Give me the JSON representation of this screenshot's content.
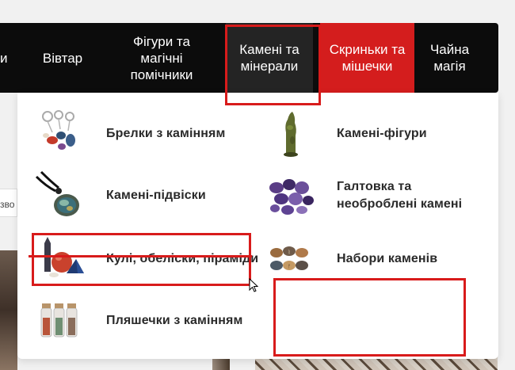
{
  "background": {
    "strip_text": "зво"
  },
  "nav": {
    "items": [
      {
        "id": "cut",
        "label": "и"
      },
      {
        "id": "altar",
        "label": "Вівтар"
      },
      {
        "id": "figures",
        "label": "Фігури та магічні помічники"
      },
      {
        "id": "stones",
        "label": "Камені та мінерали",
        "active": true
      },
      {
        "id": "boxes",
        "label": "Скриньки та мішечки",
        "promo": true
      },
      {
        "id": "tea",
        "label": "Чайна магія"
      }
    ]
  },
  "dropdown": {
    "items": [
      {
        "id": "keychains",
        "label": "Брелки з камінням",
        "icon": "keychain-stones-icon"
      },
      {
        "id": "figurines",
        "label": "Камені-фігури",
        "icon": "stone-figurine-icon"
      },
      {
        "id": "pendants",
        "label": "Камені-підвіски",
        "icon": "stone-pendant-icon"
      },
      {
        "id": "tumbled",
        "label": "Галтовка та необроблені камені",
        "icon": "tumbled-stones-icon"
      },
      {
        "id": "spheres",
        "label": "Кулі, обеліски, піраміди",
        "icon": "sphere-obelisk-pyramid-icon"
      },
      {
        "id": "sets",
        "label": "Набори каменів",
        "icon": "stone-set-icon"
      },
      {
        "id": "bottles",
        "label": "Пляшечки з камінням",
        "icon": "stone-bottles-icon"
      }
    ]
  },
  "colors": {
    "nav_bg": "#0c0c0c",
    "nav_active_bg": "#242424",
    "promo_bg": "#d41d1d",
    "annotation": "#d81b1b"
  }
}
